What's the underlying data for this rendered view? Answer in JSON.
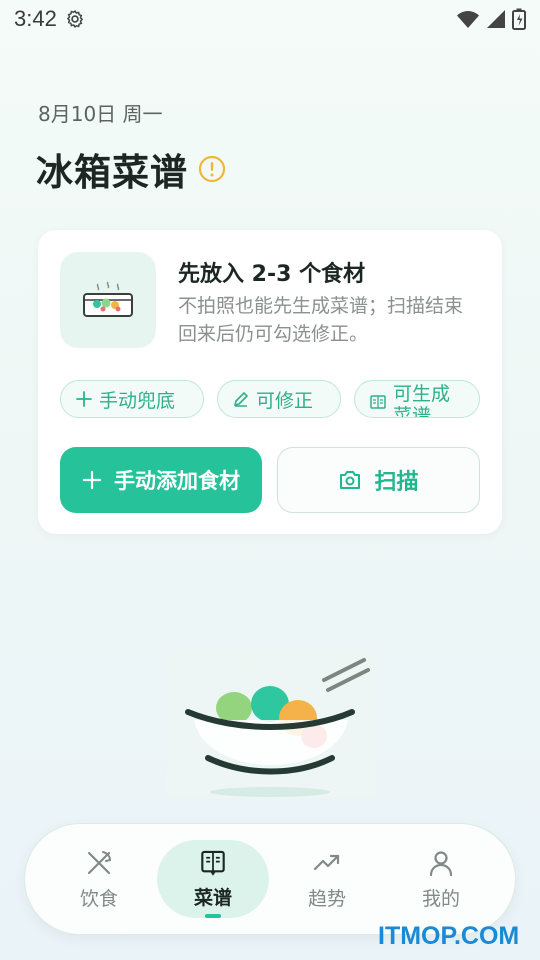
{
  "status_bar": {
    "time": "3:42",
    "icons": [
      "gear-icon",
      "wifi-icon",
      "cell-signal-icon",
      "battery-icon"
    ]
  },
  "header": {
    "date": "8月10日 周一",
    "title": "冰箱菜谱",
    "info_icon": "alert-circle-icon"
  },
  "card": {
    "heading": "先放入 2-3 个食材",
    "description": "不拍照也能先生成菜谱；扫描结束回来后仍可勾选修正。",
    "chips": [
      {
        "icon": "plus-icon",
        "label": "手动兜底"
      },
      {
        "icon": "pencil-icon",
        "label": "可修正"
      },
      {
        "icon": "book-icon",
        "label": "可生成菜谱"
      }
    ],
    "primary_button": {
      "icon": "plus-icon",
      "label": "手动添加食材"
    },
    "secondary_button": {
      "icon": "camera-icon",
      "label": "扫描"
    }
  },
  "bottom_nav": {
    "items": [
      {
        "icon": "utensils-crossed-icon",
        "label": "饮食"
      },
      {
        "icon": "recipe-book-icon",
        "label": "菜谱"
      },
      {
        "icon": "trending-up-icon",
        "label": "趋势"
      },
      {
        "icon": "user-icon",
        "label": "我的"
      }
    ],
    "active": "菜谱"
  },
  "watermark": "ITMOP.COM",
  "colors": {
    "accent": "#26c39a",
    "accent_text": "#2fb08a",
    "chip_border": "#bfe7da",
    "warning": "#f0b63a"
  }
}
